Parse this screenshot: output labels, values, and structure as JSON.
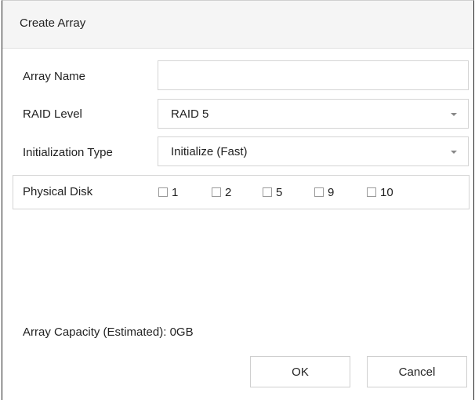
{
  "dialog": {
    "title": "Create Array"
  },
  "form": {
    "array_name": {
      "label": "Array Name",
      "value": ""
    },
    "raid_level": {
      "label": "RAID Level",
      "value": "RAID 5"
    },
    "init_type": {
      "label": "Initialization Type",
      "value": "Initialize (Fast)"
    },
    "physical_disk": {
      "label": "Physical Disk",
      "disks": [
        {
          "label": "1",
          "checked": false
        },
        {
          "label": "2",
          "checked": false
        },
        {
          "label": "5",
          "checked": false
        },
        {
          "label": "9",
          "checked": false
        },
        {
          "label": "10",
          "checked": false
        }
      ]
    }
  },
  "capacity": {
    "label": "Array Capacity (Estimated):",
    "value": "0GB"
  },
  "buttons": {
    "ok": "OK",
    "cancel": "Cancel"
  },
  "icons": {
    "dropdown": "chevron-down-icon",
    "checkbox": "checkbox-unchecked-icon"
  },
  "colors": {
    "titlebar_bg": "#f5f5f5",
    "border": "#d4d4d4",
    "text": "#222222"
  }
}
